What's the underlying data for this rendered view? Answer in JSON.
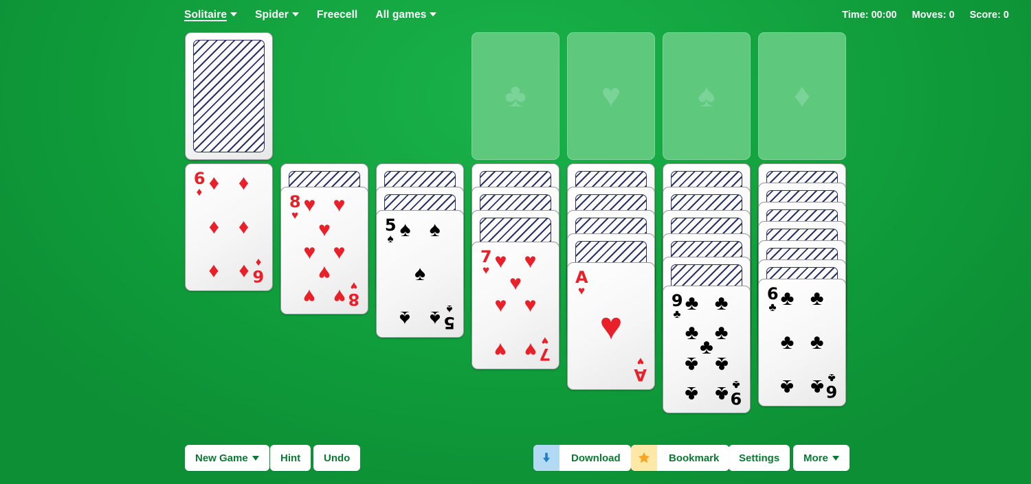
{
  "nav": {
    "items": [
      {
        "label": "Solitaire",
        "caret": true,
        "active": true
      },
      {
        "label": "Spider",
        "caret": true,
        "active": false
      },
      {
        "label": "Freecell",
        "caret": false,
        "active": false
      },
      {
        "label": "All games",
        "caret": true,
        "active": false
      }
    ]
  },
  "status": {
    "time": "Time: 00:00",
    "moves": "Moves: 0",
    "score": "Score: 0"
  },
  "foundations": [
    {
      "suit": "club",
      "symbol": "♣"
    },
    {
      "suit": "heart",
      "symbol": "♥"
    },
    {
      "suit": "spade",
      "symbol": "♠"
    },
    {
      "suit": "diamond",
      "symbol": "♦"
    }
  ],
  "stock": {
    "label": "stock-pile",
    "face_down_count": 1
  },
  "waste": {
    "label": "waste-pile",
    "empty": true
  },
  "tableau": [
    {
      "column": 1,
      "face_down": 0,
      "face_up": {
        "rank": "6",
        "suit": "diamond",
        "symbol": "♦",
        "color": "red"
      }
    },
    {
      "column": 2,
      "face_down": 1,
      "face_up": {
        "rank": "8",
        "suit": "heart",
        "symbol": "♥",
        "color": "red"
      }
    },
    {
      "column": 3,
      "face_down": 2,
      "face_up": {
        "rank": "5",
        "suit": "spade",
        "symbol": "♠",
        "color": "black"
      }
    },
    {
      "column": 4,
      "face_down": 3,
      "face_up": {
        "rank": "7",
        "suit": "heart",
        "symbol": "♥",
        "color": "red"
      }
    },
    {
      "column": 5,
      "face_down": 4,
      "face_up": {
        "rank": "A",
        "suit": "heart",
        "symbol": "♥",
        "color": "red"
      }
    },
    {
      "column": 6,
      "face_down": 5,
      "face_up": {
        "rank": "9",
        "suit": "club",
        "symbol": "♣",
        "color": "black"
      }
    },
    {
      "column": 7,
      "face_down": 6,
      "face_up": {
        "rank": "6",
        "suit": "club",
        "symbol": "♣",
        "color": "black"
      }
    }
  ],
  "toolbar": {
    "new_game": "New Game",
    "hint": "Hint",
    "undo": "Undo",
    "download": "Download",
    "bookmark": "Bookmark",
    "settings": "Settings",
    "more": "More"
  },
  "colors": {
    "felt_green": "#14a641",
    "felt_green_dark": "#0d8f35",
    "foundation_slot": "#5ec87d",
    "card_red": "#e8202a",
    "card_black": "#000000",
    "card_back_navy": "#2b3163",
    "button_text_green": "#0a7a33",
    "download_icon_bg": "#b3daf5",
    "download_arrow": "#1f7ec4",
    "bookmark_icon_bg": "#fde8a8",
    "bookmark_star": "#f5a623"
  }
}
